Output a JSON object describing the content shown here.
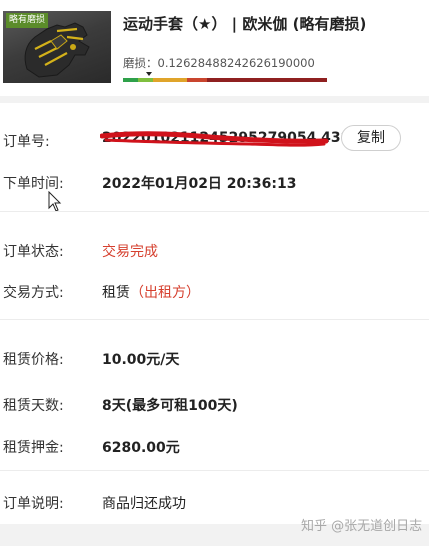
{
  "item": {
    "wear_tag": "略有磨损",
    "title": "运动手套（★） | 欧米伽 (略有磨损)",
    "wear_label": "磨损：",
    "wear_value": "0.12628488242626190000",
    "wear_fraction": 0.126,
    "wear_bar_colors": [
      "#2fa14a",
      "#7fbf3f",
      "#e0a42a",
      "#c9452e",
      "#8f2020"
    ]
  },
  "order": {
    "number_label": "订单号:",
    "number_value": "2022010211245295279054 4384",
    "copy_label": "复制",
    "time_label": "下单时间:",
    "time_value": "2022年01月02日 20:36:13",
    "status_label": "订单状态:",
    "status_value": "交易完成",
    "method_label": "交易方式:",
    "method_value": "租赁",
    "method_suffix": "（出租方）",
    "price_label": "租赁价格:",
    "price_value": "10.00元/天",
    "days_label": "租赁天数:",
    "days_value": "8天(最多可租100天)",
    "deposit_label": "租赁押金:",
    "deposit_value": "6280.00元",
    "note_label": "订单说明:",
    "note_value": "商品归还成功"
  },
  "watermark": "知乎 @张无道创日志",
  "colors": {
    "status_red": "#d6402f",
    "redaction_red": "#d0121b",
    "wear_tag_green": "#5b8c2a"
  }
}
